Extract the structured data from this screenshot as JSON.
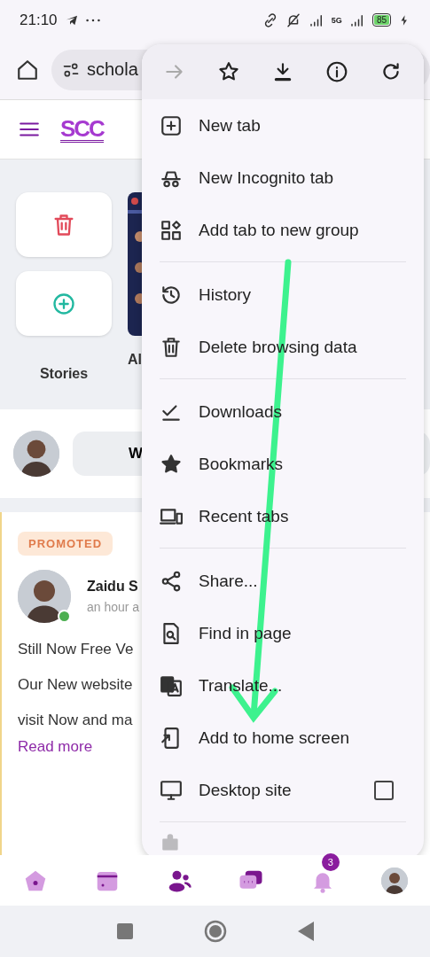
{
  "status_bar": {
    "time": "21:10",
    "network": "5G",
    "battery": "85"
  },
  "browser": {
    "url": "schola"
  },
  "site": {
    "logo": "SCC"
  },
  "stories": {
    "labels": [
      "Stories",
      "Al"
    ]
  },
  "composer": {
    "prompt": "W"
  },
  "post": {
    "badge": "PROMOTED",
    "author": "Zaidu S",
    "time": "an hour a",
    "online": true,
    "lines": [
      "Still Now Free Ve",
      "Our New website",
      "visit Now and ma"
    ],
    "link": "Read more"
  },
  "bottom_nav": {
    "items": [
      {
        "selected": false
      },
      {
        "selected": false
      },
      {
        "selected": true
      },
      {
        "selected": false
      },
      {
        "selected": false,
        "badge": "3"
      },
      {
        "selected": false
      }
    ]
  },
  "menu": {
    "top_actions": [
      {
        "disabled": true
      },
      {
        "disabled": false
      },
      {
        "disabled": false
      },
      {
        "disabled": false
      },
      {
        "disabled": false
      }
    ],
    "sections": [
      [
        {
          "label": "New tab",
          "kind": "action"
        },
        {
          "label": "New Incognito tab",
          "kind": "action"
        },
        {
          "label": "Add tab to new group",
          "kind": "action"
        }
      ],
      [
        {
          "label": "History",
          "kind": "action"
        },
        {
          "label": "Delete browsing data",
          "kind": "action"
        }
      ],
      [
        {
          "label": "Downloads",
          "kind": "action"
        },
        {
          "label": "Bookmarks",
          "kind": "action"
        },
        {
          "label": "Recent tabs",
          "kind": "action"
        }
      ],
      [
        {
          "label": "Share...",
          "kind": "action"
        },
        {
          "label": "Find in page",
          "kind": "action"
        },
        {
          "label": "Translate...",
          "kind": "action"
        },
        {
          "label": "Add to home screen",
          "kind": "action"
        },
        {
          "label": "Desktop site",
          "kind": "checkbox",
          "checked": false
        }
      ]
    ]
  }
}
